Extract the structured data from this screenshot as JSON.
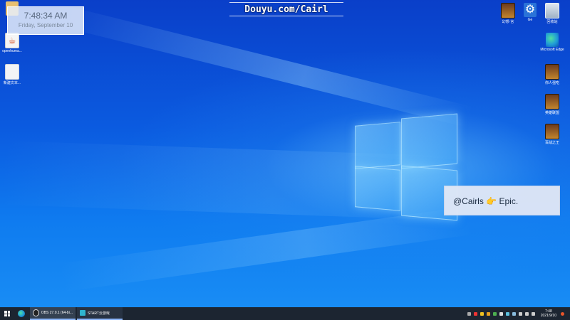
{
  "overlay": {
    "text": "Douyu.com/Cairl"
  },
  "clock_widget": {
    "time": "7:48:34 AM",
    "date": "Friday, September 10"
  },
  "desktop_icons_left": [
    {
      "label": "",
      "icon": "folder-icon"
    },
    {
      "label": "openhuma...",
      "icon": "java-icon"
    },
    {
      "label": "新建文本...",
      "icon": "text-file-icon"
    }
  ],
  "desktop_icons_right": [
    {
      "label": "幻想·言",
      "icon": "game-icon"
    },
    {
      "label": "Ge",
      "icon": "gear-icon"
    },
    {
      "label": "回收站",
      "icon": "recycle-bin-icon"
    },
    {
      "label": "Microsoft Edge",
      "icon": "edge-icon"
    },
    {
      "label": "你人强吃",
      "icon": "game-icon"
    },
    {
      "label": "英雄联盟",
      "icon": "game-icon"
    },
    {
      "label": "百战之王",
      "icon": "game-icon"
    }
  ],
  "notification": {
    "prefix": "@Cairls",
    "emoji": "👉",
    "suffix": "Epic."
  },
  "taskbar": {
    "apps": [
      {
        "label": "OBS 27.0.1 (64-bi...",
        "icon": "obs-icon"
      },
      {
        "label": "START云游戏",
        "icon": "start-app-icon"
      }
    ],
    "clock": {
      "time": "7:48",
      "date": "2021/9/10"
    }
  },
  "colors": {
    "desktop_top": "#0a3fc9",
    "desktop_bottom": "#1a8ff5",
    "taskbar": "#1c2531",
    "notification_bg": "#e1e8f6"
  }
}
